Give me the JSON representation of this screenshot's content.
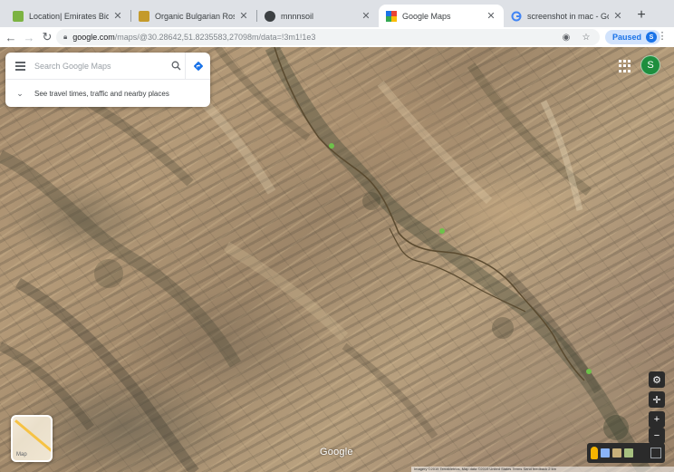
{
  "tabs": [
    {
      "title": "Location| Emirates Bio Farm",
      "favicon": "leaf-favicon",
      "active": false
    },
    {
      "title": "Organic Bulgarian Rose Water",
      "favicon": "bottle-favicon",
      "active": false
    },
    {
      "title": "mnnnsoil",
      "favicon": "globe-favicon",
      "active": false
    },
    {
      "title": "Google Maps",
      "favicon": "google-maps-favicon",
      "active": true
    },
    {
      "title": "screenshot in mac - Google Se",
      "favicon": "google-favicon",
      "active": false
    }
  ],
  "toolbar": {
    "url_host": "google.com",
    "url_path": "/maps/@30.28642,51.8235583,27098m/data=!3m1!1e3",
    "profile_status": "Paused",
    "profile_initial": "S"
  },
  "search": {
    "placeholder": "Search Google Maps",
    "travel_prompt": "See travel times, traffic and nearby places"
  },
  "map": {
    "account_initial": "S",
    "layers_label": "Map",
    "logo": "Google",
    "attribution": "Imagery ©2019 TerraMetrics, Map data ©2019   United States   Terms   Send feedback   2 km",
    "colors": {
      "route": "#5a4a2f",
      "accent_green": "#6ec24a",
      "profile": "#1e8e3e",
      "paused_bg": "#d2e3fc"
    }
  }
}
